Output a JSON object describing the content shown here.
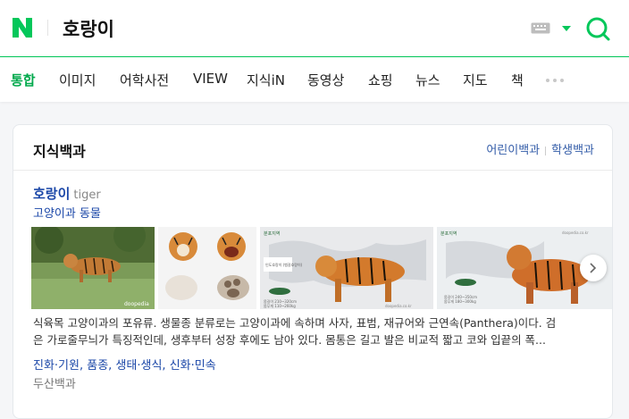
{
  "search": {
    "logo_letter": "N",
    "query": "호랑이",
    "colors": {
      "brand": "#03c75a",
      "link": "#1b47a8"
    }
  },
  "tabs": [
    {
      "label": "통합",
      "active": true
    },
    {
      "label": "이미지"
    },
    {
      "label": "어학사전"
    },
    {
      "label": "VIEW"
    },
    {
      "label": "지식iN"
    },
    {
      "label": "동영상"
    },
    {
      "label": "쇼핑"
    },
    {
      "label": "뉴스"
    },
    {
      "label": "지도"
    },
    {
      "label": "책"
    }
  ],
  "card": {
    "title": "지식백과",
    "links": [
      "어린이백과",
      "학생백과"
    ],
    "entry": {
      "name": "호랑이",
      "name_en": "tiger",
      "category": "고양이과 동물",
      "description_lines": [
        "식육목 고양이과의 포유류. 생물종 분류로는 고양이과에 속하며 사자, 표범, 재규어와 근연속(Panthera)이다. 검",
        "은 가로줄무늬가 특징적인데, 생후부터 성장 후에도 남아 있다. 몸통은 길고 발은 비교적 짧고 코와 입끝의 폭..."
      ],
      "sub_links": [
        "진화·기원",
        "품종",
        "생태·생식",
        "신화·민속"
      ],
      "source": "두산백과"
    },
    "thumb_text": {
      "t1_watermark": "doopedia",
      "t3_top": "분포지역",
      "t3_box": "인도호랑이 (벵갈호랑이)",
      "t3_size": "몸길이 210~320cm",
      "t3_weight": "몸무게 110~260kg",
      "t3_credit": "doopedia.co.kr",
      "t4_top": "분포지역",
      "t4_size1": "몸길이 240~350cm",
      "t4_size2": "몸무게 180~300kg",
      "t4_credit": "doopedia.co.kr"
    }
  }
}
